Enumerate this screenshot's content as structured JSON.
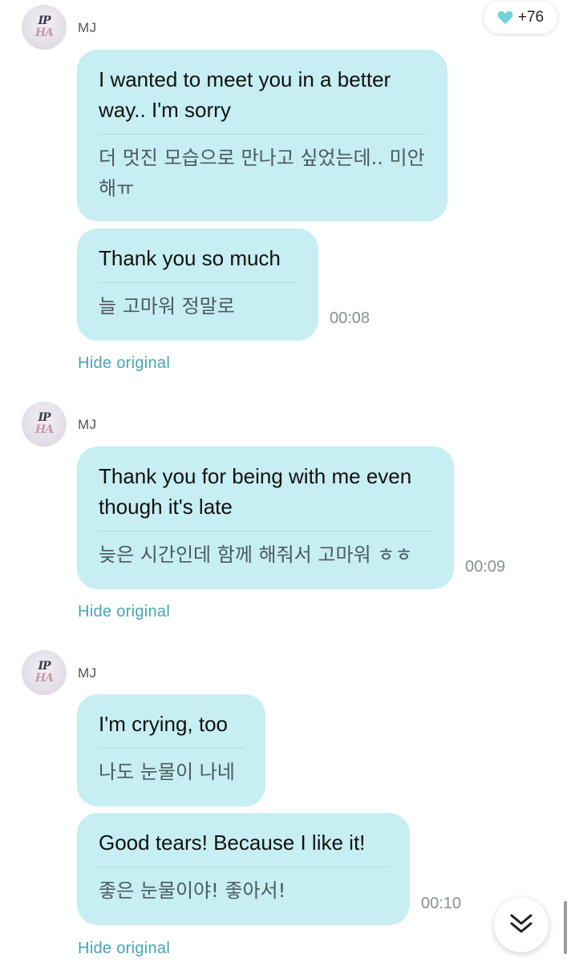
{
  "reaction": {
    "icon": "heart-icon",
    "color": "#6fd3dc",
    "count": "+76"
  },
  "groups": [
    {
      "sender": "MJ",
      "avatar_text": [
        "IP",
        "HA"
      ],
      "messages": [
        {
          "english": "I wanted to meet you in a better way.. I'm sorry",
          "korean": "더 멋진 모습으로 만나고 싶었는데.. 미안해ㅠ",
          "time": ""
        },
        {
          "english": "Thank you so much",
          "korean": "늘 고마워 정말로",
          "time": "00:08"
        }
      ],
      "toggle_label": "Hide original"
    },
    {
      "sender": "MJ",
      "avatar_text": [
        "IP",
        "HA"
      ],
      "messages": [
        {
          "english": "Thank you for being with me even though it's late",
          "korean": "늦은 시간인데 함께 해줘서 고마워 ㅎㅎ",
          "time": "00:09"
        }
      ],
      "toggle_label": "Hide original"
    },
    {
      "sender": "MJ",
      "avatar_text": [
        "IP",
        "HA"
      ],
      "messages": [
        {
          "english": "I'm crying, too",
          "korean": "나도 눈물이 나네",
          "time": ""
        },
        {
          "english": "Good tears! Because I like it!",
          "korean": "좋은 눈물이야! 좋아서!",
          "time": "00:10"
        }
      ],
      "toggle_label": "Hide original"
    }
  ],
  "scroll_button": {
    "icon": "double-chevron-down-icon"
  },
  "colors": {
    "bubble": "#c6eef3",
    "link": "#4aa3b5",
    "timestamp": "#8a8f92"
  }
}
